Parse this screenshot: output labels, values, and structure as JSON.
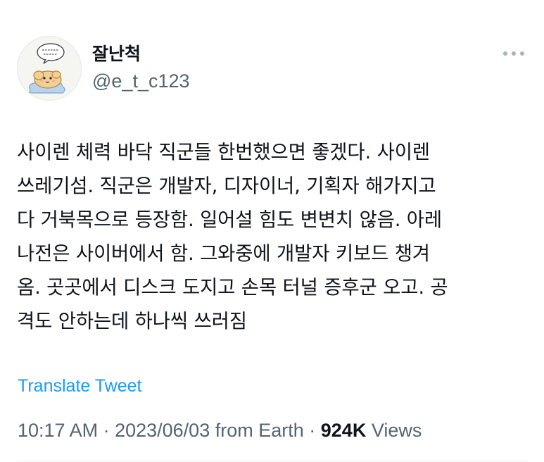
{
  "author": {
    "display_name": "잘난척",
    "handle": "@e_t_c123",
    "avatar_icon": "cartoon-character-avatar-icon",
    "avatar_bubble_text": "이제겐가..\n왜글러아.."
  },
  "tweet": {
    "text": "사이렌 체력 바닥 직군들 한번했으면 좋겠다. 사이렌\n쓰레기섬. 직군은 개발자, 디자이너, 기획자 해가지고\n다 거북목으로 등장함. 일어설 힘도 변변치 않음. 아레\n나전은 사이버에서 함. 그와중에 개발자 키보드 챙겨\n옴. 곳곳에서 디스크 도지고 손목 터널 증후군 오고. 공\n격도 안하는데 하나씩 쓰러짐",
    "translate_label": "Translate Tweet"
  },
  "meta": {
    "time": "10:17 AM",
    "sep1": " · ",
    "date": "2023/06/03",
    "from_text": " from Earth",
    "sep2": " · ",
    "views_count": "924K",
    "views_label": " Views"
  },
  "icons": {
    "more": "more-horizontal-icon"
  },
  "colors": {
    "text_primary": "#0f1419",
    "text_secondary": "#536471",
    "link": "#1d9bf0",
    "divider": "#eff3f4"
  }
}
